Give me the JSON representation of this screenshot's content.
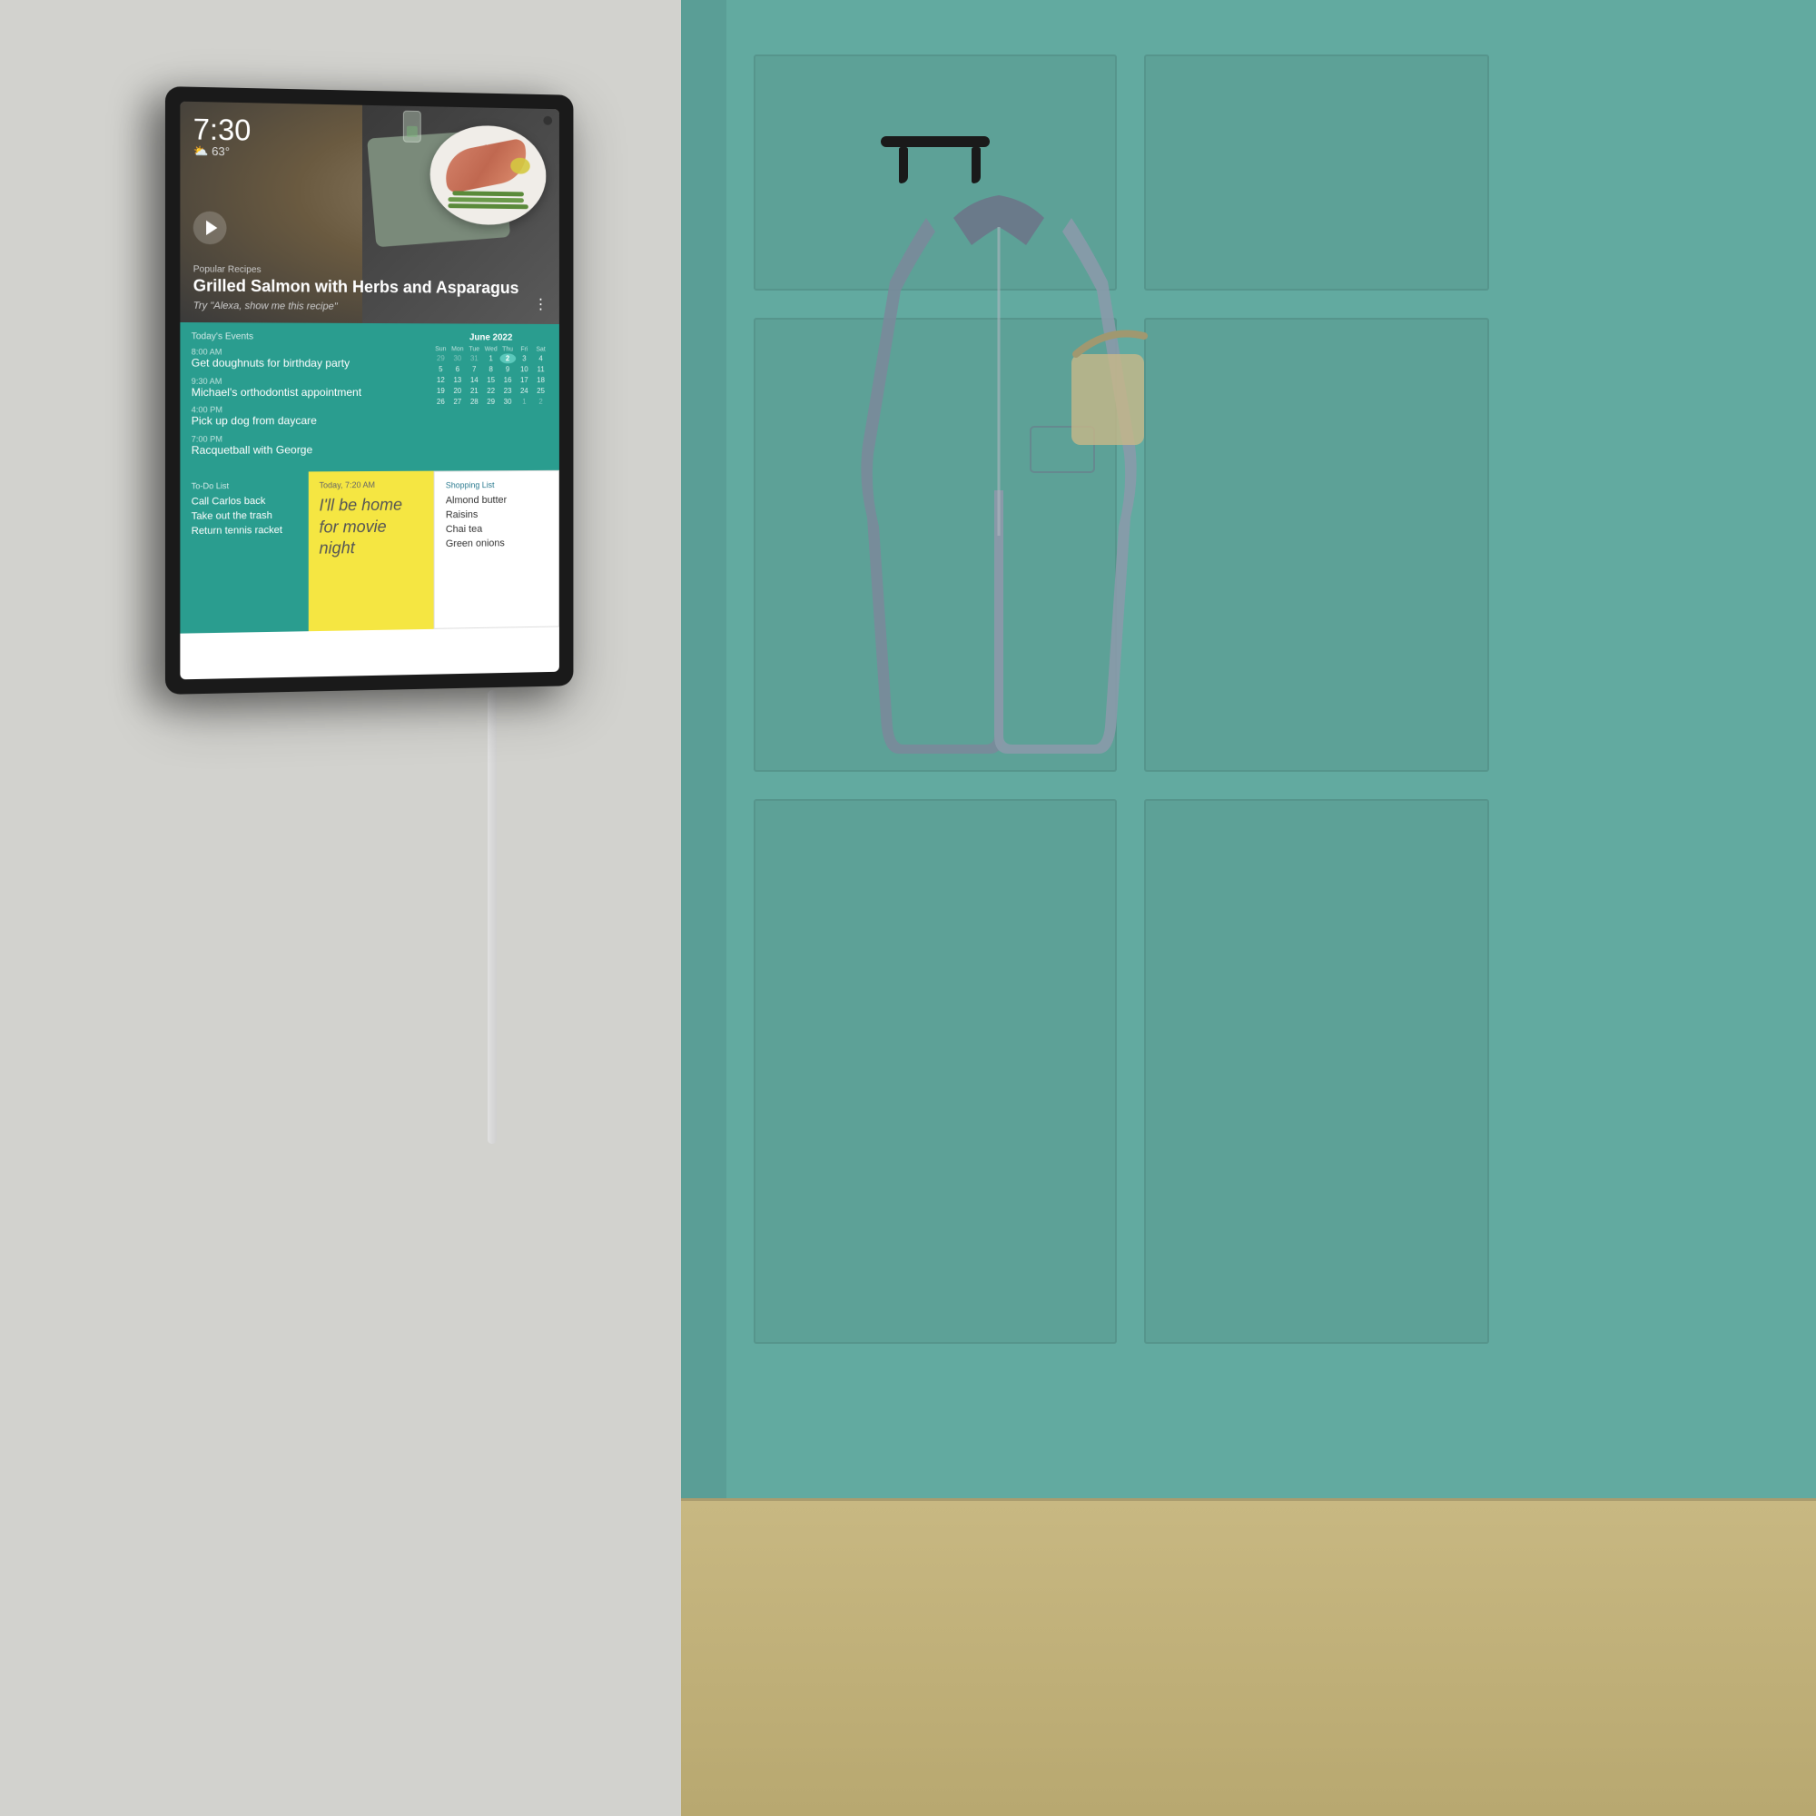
{
  "wall": {
    "left_color": "#d2d2ce",
    "right_color": "#62aaa0"
  },
  "device": {
    "frame_color": "#1a1a1a"
  },
  "screen": {
    "hero": {
      "time": "7:30",
      "weather": "63°",
      "category": "Popular Recipes",
      "title": "Grilled Salmon with Herbs and Asparagus",
      "subtitle": "Try \"Alexa, show me this recipe\""
    },
    "calendar": {
      "section_label": "Today's Events",
      "month": "June 2022",
      "events": [
        {
          "time": "8:00 AM",
          "title": "Get doughnuts for birthday party"
        },
        {
          "time": "9:30 AM",
          "title": "Michael's orthodontist appointment"
        },
        {
          "time": "4:00 PM",
          "title": "Pick up dog from daycare"
        },
        {
          "time": "7:00 PM",
          "title": "Racquetball with George"
        }
      ],
      "day_labels": [
        "Sun",
        "Mon",
        "Tue",
        "Wed",
        "Thu",
        "Fri",
        "Sat"
      ],
      "days": [
        {
          "n": "29",
          "prev": true
        },
        {
          "n": "30",
          "prev": true
        },
        {
          "n": "31",
          "prev": true
        },
        {
          "n": "1",
          "today": false
        },
        {
          "n": "2",
          "today": true
        },
        {
          "n": "3",
          "today": false
        },
        {
          "n": "4",
          "today": false
        },
        {
          "n": "5"
        },
        {
          "n": "6"
        },
        {
          "n": "7"
        },
        {
          "n": "8"
        },
        {
          "n": "9"
        },
        {
          "n": "10"
        },
        {
          "n": "11"
        },
        {
          "n": "12"
        },
        {
          "n": "13"
        },
        {
          "n": "14"
        },
        {
          "n": "15"
        },
        {
          "n": "16"
        },
        {
          "n": "17"
        },
        {
          "n": "18"
        },
        {
          "n": "19"
        },
        {
          "n": "20"
        },
        {
          "n": "21"
        },
        {
          "n": "22"
        },
        {
          "n": "23"
        },
        {
          "n": "24"
        },
        {
          "n": "25"
        },
        {
          "n": "26"
        },
        {
          "n": "27"
        },
        {
          "n": "28"
        },
        {
          "n": "29"
        },
        {
          "n": "30"
        },
        {
          "n": "1",
          "next": true
        },
        {
          "n": "2",
          "next": true
        }
      ]
    },
    "todo": {
      "label": "To-Do List",
      "items": [
        "Call Carlos back",
        "Take out the trash",
        "Return tennis racket"
      ]
    },
    "note": {
      "timestamp": "Today, 7:20 AM",
      "text": "I'll be home for movie night"
    },
    "shopping": {
      "label": "Shopping List",
      "items": [
        "Almond butter",
        "Raisins",
        "Chai tea",
        "Green onions"
      ]
    }
  }
}
